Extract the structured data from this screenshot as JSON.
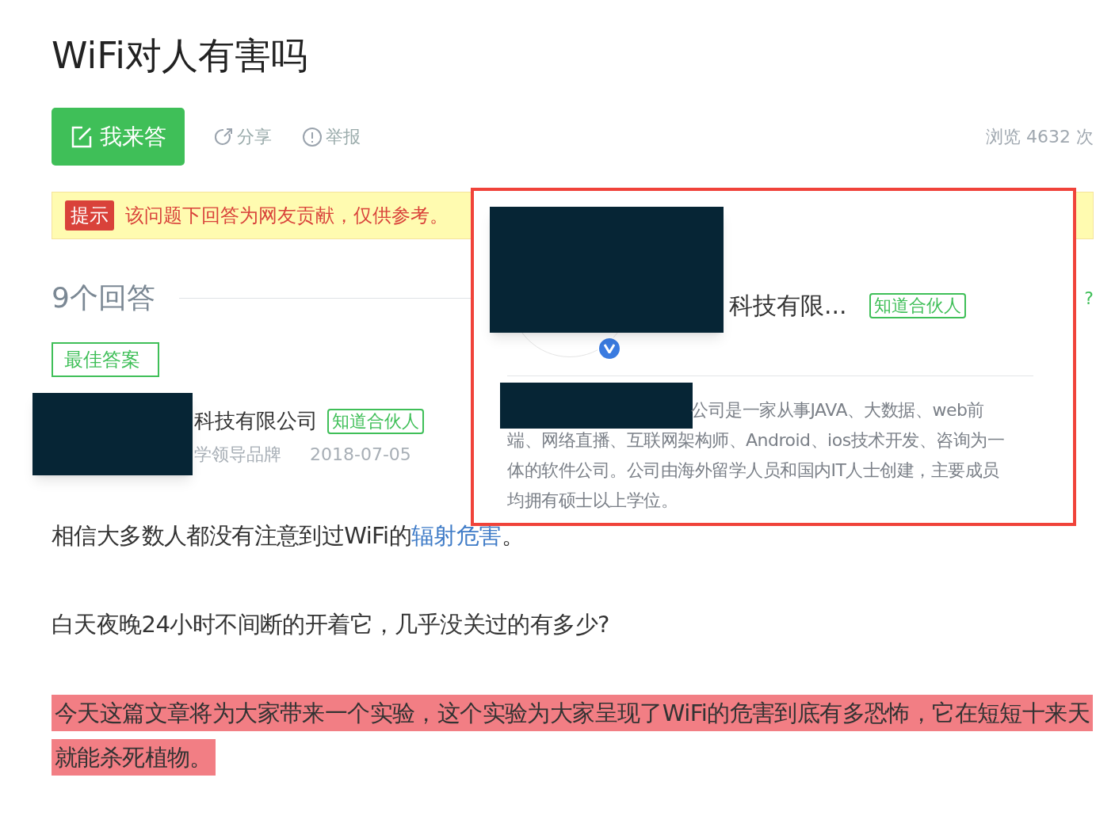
{
  "question": {
    "title": "WiFi对人有害吗"
  },
  "actions": [
    {
      "kind": "primary",
      "label": "我来答"
    },
    {
      "kind": "share",
      "label": "分享"
    },
    {
      "kind": "report",
      "label": "举报"
    }
  ],
  "views": "浏览 4632 次",
  "notice": {
    "badge": "提示",
    "text": "该问题下回答为网友贡献，仅供参考。"
  },
  "answers_header": {
    "count": "9个回答",
    "help": "?"
  },
  "best_answer": {
    "badge": "最佳答案",
    "author": "科技有限公司",
    "author_tag": "知道合伙人",
    "author_subtitle": "学领导品牌",
    "date": "2018-07-05",
    "paragraphs": [
      {
        "highlighted": false,
        "parts": [
          {
            "kind": "text",
            "text": "相信大多数人都没有注意到过WiFi的"
          },
          {
            "kind": "link",
            "text": "辐射危害"
          },
          {
            "kind": "text",
            "text": "。"
          }
        ]
      },
      {
        "highlighted": false,
        "parts": [
          {
            "kind": "text",
            "text": "白天夜晚24小时不间断的开着它，几乎没关过的有多少?"
          }
        ]
      },
      {
        "highlighted": true,
        "parts": [
          {
            "kind": "text",
            "text": "今天这篇文章将为大家带来一个实验，这个实验为大家呈现了WiFi的危害到底有多恐怖，它在短短十来天就能杀死植物。"
          }
        ]
      }
    ]
  },
  "popup": {
    "name": "科技有限...",
    "tag": "知道合伙人",
    "verified": true,
    "description": "公司是一家从事JAVA、大数据、web前端、网络直播、互联网架构师、Android、ios技术开发、咨询为一体的软件公司。公司由海外留学人员和国内IT人士创建，主要成员均拥有硕士以上学位。"
  }
}
